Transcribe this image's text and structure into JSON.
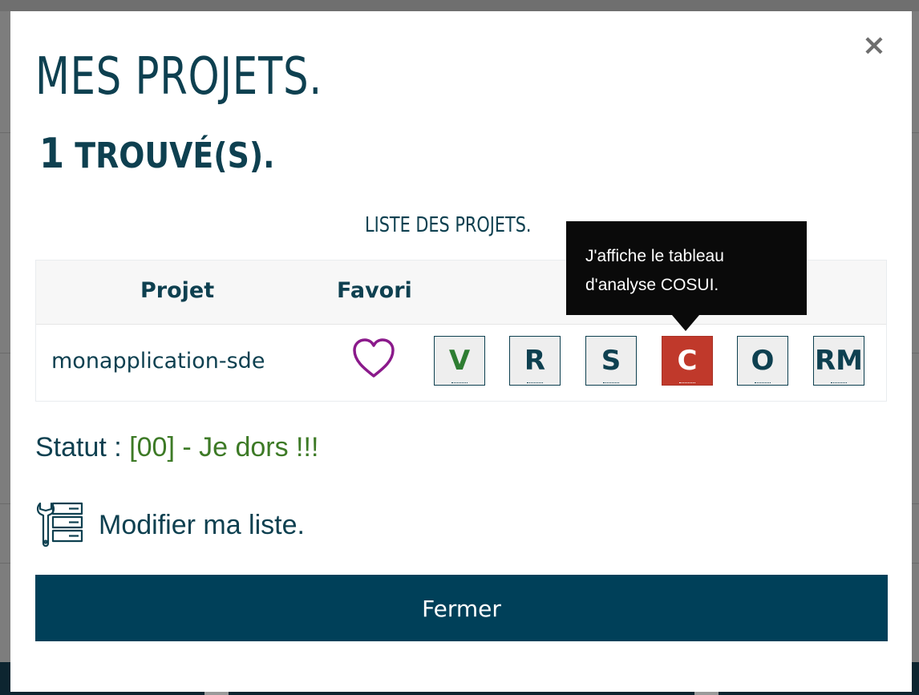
{
  "modal": {
    "close_symbol": "×",
    "title": "MES PROJETS.",
    "found_count": "1",
    "found_suffix": "TROUVÉ(S).",
    "list_title": "LISTE DES PROJETS.",
    "table": {
      "headers": [
        "Projet",
        "Favori"
      ],
      "rows": [
        {
          "name": "monapplication-sde",
          "favorite_icon": "heart-outline-icon",
          "actions": [
            {
              "label": "V"
            },
            {
              "label": "R"
            },
            {
              "label": "S"
            },
            {
              "label": "C"
            },
            {
              "label": "O"
            },
            {
              "label": "RM"
            }
          ]
        }
      ]
    },
    "tooltip": {
      "text": "J'affiche le tableau d'analyse COSUI."
    },
    "status": {
      "label": "Statut : ",
      "value": "[00] - Je dors !!!"
    },
    "modify_link": {
      "icon": "server-wrench-icon",
      "label": "Modifier ma liste."
    },
    "close_button_label": "Fermer"
  },
  "colors": {
    "primary": "#004059",
    "title_text": "#0e4050",
    "status_value": "#3d7a26",
    "active_button": "#c0392b",
    "favorite_heart": "#8b1a8b",
    "tooltip_bg": "#0a0a0a"
  }
}
